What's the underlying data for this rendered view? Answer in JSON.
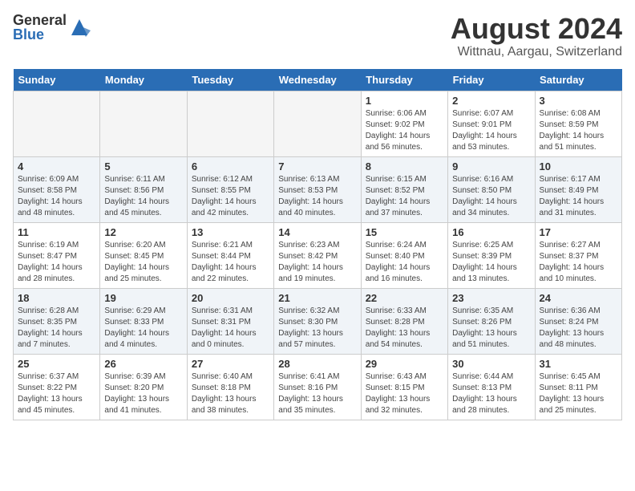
{
  "logo": {
    "general": "General",
    "blue": "Blue"
  },
  "header": {
    "month_year": "August 2024",
    "location": "Wittnau, Aargau, Switzerland"
  },
  "weekdays": [
    "Sunday",
    "Monday",
    "Tuesday",
    "Wednesday",
    "Thursday",
    "Friday",
    "Saturday"
  ],
  "weeks": [
    [
      {
        "day": "",
        "info": ""
      },
      {
        "day": "",
        "info": ""
      },
      {
        "day": "",
        "info": ""
      },
      {
        "day": "",
        "info": ""
      },
      {
        "day": "1",
        "info": "Sunrise: 6:06 AM\nSunset: 9:02 PM\nDaylight: 14 hours\nand 56 minutes."
      },
      {
        "day": "2",
        "info": "Sunrise: 6:07 AM\nSunset: 9:01 PM\nDaylight: 14 hours\nand 53 minutes."
      },
      {
        "day": "3",
        "info": "Sunrise: 6:08 AM\nSunset: 8:59 PM\nDaylight: 14 hours\nand 51 minutes."
      }
    ],
    [
      {
        "day": "4",
        "info": "Sunrise: 6:09 AM\nSunset: 8:58 PM\nDaylight: 14 hours\nand 48 minutes."
      },
      {
        "day": "5",
        "info": "Sunrise: 6:11 AM\nSunset: 8:56 PM\nDaylight: 14 hours\nand 45 minutes."
      },
      {
        "day": "6",
        "info": "Sunrise: 6:12 AM\nSunset: 8:55 PM\nDaylight: 14 hours\nand 42 minutes."
      },
      {
        "day": "7",
        "info": "Sunrise: 6:13 AM\nSunset: 8:53 PM\nDaylight: 14 hours\nand 40 minutes."
      },
      {
        "day": "8",
        "info": "Sunrise: 6:15 AM\nSunset: 8:52 PM\nDaylight: 14 hours\nand 37 minutes."
      },
      {
        "day": "9",
        "info": "Sunrise: 6:16 AM\nSunset: 8:50 PM\nDaylight: 14 hours\nand 34 minutes."
      },
      {
        "day": "10",
        "info": "Sunrise: 6:17 AM\nSunset: 8:49 PM\nDaylight: 14 hours\nand 31 minutes."
      }
    ],
    [
      {
        "day": "11",
        "info": "Sunrise: 6:19 AM\nSunset: 8:47 PM\nDaylight: 14 hours\nand 28 minutes."
      },
      {
        "day": "12",
        "info": "Sunrise: 6:20 AM\nSunset: 8:45 PM\nDaylight: 14 hours\nand 25 minutes."
      },
      {
        "day": "13",
        "info": "Sunrise: 6:21 AM\nSunset: 8:44 PM\nDaylight: 14 hours\nand 22 minutes."
      },
      {
        "day": "14",
        "info": "Sunrise: 6:23 AM\nSunset: 8:42 PM\nDaylight: 14 hours\nand 19 minutes."
      },
      {
        "day": "15",
        "info": "Sunrise: 6:24 AM\nSunset: 8:40 PM\nDaylight: 14 hours\nand 16 minutes."
      },
      {
        "day": "16",
        "info": "Sunrise: 6:25 AM\nSunset: 8:39 PM\nDaylight: 14 hours\nand 13 minutes."
      },
      {
        "day": "17",
        "info": "Sunrise: 6:27 AM\nSunset: 8:37 PM\nDaylight: 14 hours\nand 10 minutes."
      }
    ],
    [
      {
        "day": "18",
        "info": "Sunrise: 6:28 AM\nSunset: 8:35 PM\nDaylight: 14 hours\nand 7 minutes."
      },
      {
        "day": "19",
        "info": "Sunrise: 6:29 AM\nSunset: 8:33 PM\nDaylight: 14 hours\nand 4 minutes."
      },
      {
        "day": "20",
        "info": "Sunrise: 6:31 AM\nSunset: 8:31 PM\nDaylight: 14 hours\nand 0 minutes."
      },
      {
        "day": "21",
        "info": "Sunrise: 6:32 AM\nSunset: 8:30 PM\nDaylight: 13 hours\nand 57 minutes."
      },
      {
        "day": "22",
        "info": "Sunrise: 6:33 AM\nSunset: 8:28 PM\nDaylight: 13 hours\nand 54 minutes."
      },
      {
        "day": "23",
        "info": "Sunrise: 6:35 AM\nSunset: 8:26 PM\nDaylight: 13 hours\nand 51 minutes."
      },
      {
        "day": "24",
        "info": "Sunrise: 6:36 AM\nSunset: 8:24 PM\nDaylight: 13 hours\nand 48 minutes."
      }
    ],
    [
      {
        "day": "25",
        "info": "Sunrise: 6:37 AM\nSunset: 8:22 PM\nDaylight: 13 hours\nand 45 minutes."
      },
      {
        "day": "26",
        "info": "Sunrise: 6:39 AM\nSunset: 8:20 PM\nDaylight: 13 hours\nand 41 minutes."
      },
      {
        "day": "27",
        "info": "Sunrise: 6:40 AM\nSunset: 8:18 PM\nDaylight: 13 hours\nand 38 minutes."
      },
      {
        "day": "28",
        "info": "Sunrise: 6:41 AM\nSunset: 8:16 PM\nDaylight: 13 hours\nand 35 minutes."
      },
      {
        "day": "29",
        "info": "Sunrise: 6:43 AM\nSunset: 8:15 PM\nDaylight: 13 hours\nand 32 minutes."
      },
      {
        "day": "30",
        "info": "Sunrise: 6:44 AM\nSunset: 8:13 PM\nDaylight: 13 hours\nand 28 minutes."
      },
      {
        "day": "31",
        "info": "Sunrise: 6:45 AM\nSunset: 8:11 PM\nDaylight: 13 hours\nand 25 minutes."
      }
    ]
  ]
}
